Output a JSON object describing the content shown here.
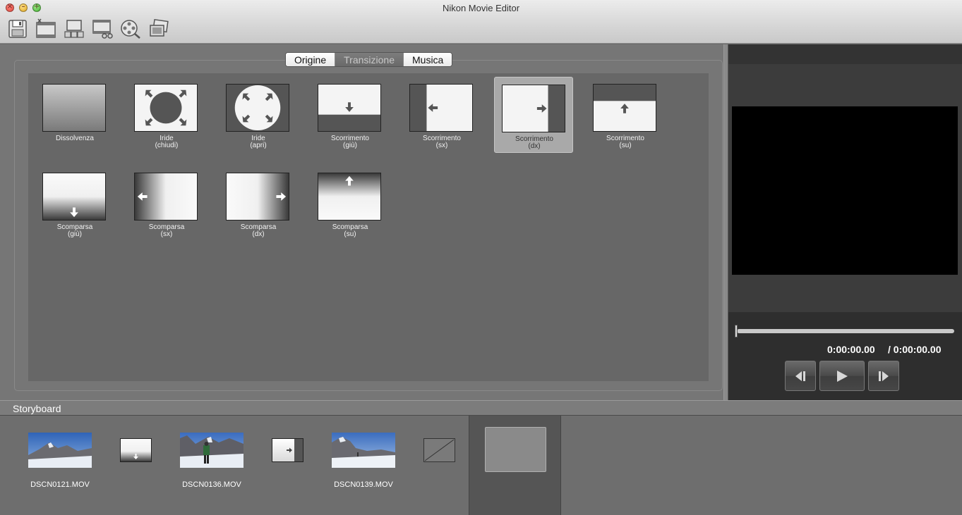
{
  "window": {
    "title": "Nikon Movie Editor"
  },
  "toolbar": [
    {
      "icon": "save-icon"
    },
    {
      "icon": "add-clip-icon"
    },
    {
      "icon": "storyboard-icon"
    },
    {
      "icon": "trim-icon"
    },
    {
      "icon": "film-reel-search-icon"
    },
    {
      "icon": "export-frame-icon"
    }
  ],
  "tabs": [
    {
      "label": "Origine",
      "active": false
    },
    {
      "label": "Transizione",
      "active": true
    },
    {
      "label": "Musica",
      "active": false
    }
  ],
  "transitions": [
    {
      "line1": "Dissolvenza",
      "line2": "",
      "kind": "dissolve",
      "selected": false
    },
    {
      "line1": "Iride",
      "line2": "(chiudi)",
      "kind": "iris-close",
      "selected": false
    },
    {
      "line1": "Iride",
      "line2": "(apri)",
      "kind": "iris-open",
      "selected": false
    },
    {
      "line1": "Scorrimento",
      "line2": "(giù)",
      "kind": "slide-down",
      "selected": false
    },
    {
      "line1": "Scorrimento",
      "line2": "(sx)",
      "kind": "slide-left",
      "selected": false
    },
    {
      "line1": "Scorrimento",
      "line2": "(dx)",
      "kind": "slide-right",
      "selected": true
    },
    {
      "line1": "Scorrimento",
      "line2": "(su)",
      "kind": "slide-up",
      "selected": false
    },
    {
      "line1": "Scomparsa",
      "line2": "(giù)",
      "kind": "fade-down",
      "selected": false
    },
    {
      "line1": "Scomparsa",
      "line2": "(sx)",
      "kind": "fade-left",
      "selected": false
    },
    {
      "line1": "Scomparsa",
      "line2": "(dx)",
      "kind": "fade-right",
      "selected": false
    },
    {
      "line1": "Scomparsa",
      "line2": "(su)",
      "kind": "fade-up",
      "selected": false
    }
  ],
  "player": {
    "current_time": "0:00:00.00",
    "total_time": "/ 0:00:00.00",
    "progress": 0
  },
  "storyboard": {
    "title": "Storyboard",
    "clips": [
      {
        "name": "DSCN0121.MOV"
      },
      {
        "name": "DSCN0136.MOV"
      },
      {
        "name": "DSCN0139.MOV"
      }
    ],
    "transitions": [
      {
        "kind": "fade-down"
      },
      {
        "kind": "slide-right"
      }
    ]
  },
  "colors": {
    "panel": "#767676",
    "grid": "#676767",
    "preview": "#000000"
  }
}
